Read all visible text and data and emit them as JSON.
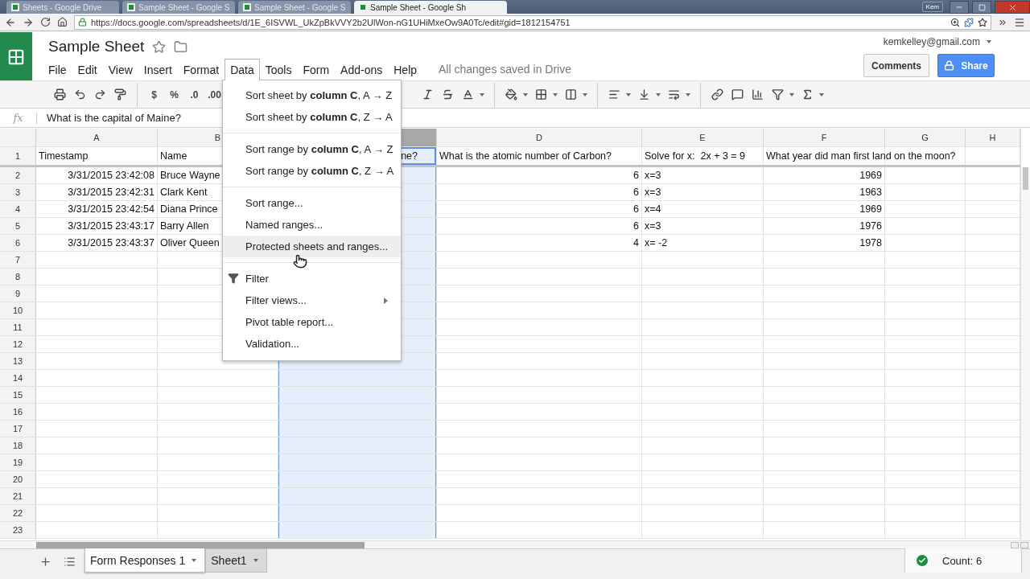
{
  "browser": {
    "tabs": [
      {
        "title": "Sheets - Google Drive",
        "selected": false
      },
      {
        "title": "Sample Sheet - Google S",
        "selected": false
      },
      {
        "title": "Sample Sheet - Google S",
        "selected": false
      },
      {
        "title": "Sample Sheet - Google Sh",
        "selected": true
      }
    ],
    "profile": "Kem",
    "url": "https://docs.google.com/spreadsheets/d/1E_6ISVWL_UkZpBkVVY2b2UlWon-nG1UHiMxeOw9A0Tc/edit#gid=1812154751"
  },
  "document": {
    "title": "Sample Sheet",
    "save_status": "All changes saved in Drive",
    "account": "kemkelley@gmail.com",
    "comments_button": "Comments",
    "share_button": "Share"
  },
  "menubar": [
    {
      "label": "File",
      "selected": false
    },
    {
      "label": "Edit",
      "selected": false
    },
    {
      "label": "View",
      "selected": false
    },
    {
      "label": "Insert",
      "selected": false
    },
    {
      "label": "Format",
      "selected": false
    },
    {
      "label": "Data",
      "selected": true
    },
    {
      "label": "Tools",
      "selected": false
    },
    {
      "label": "Form",
      "selected": false
    },
    {
      "label": "Add-ons",
      "selected": false
    },
    {
      "label": "Help",
      "selected": false
    }
  ],
  "toolbar": {
    "number_formats": [
      "$",
      "%",
      ".0",
      ".00"
    ]
  },
  "formula_bar": {
    "label": "fx",
    "value": "What is the capital of Maine?"
  },
  "sheet": {
    "columns": [
      {
        "label": "A",
        "selected": false
      },
      {
        "label": "B",
        "selected": false
      },
      {
        "selected": true
      },
      {
        "label": "D",
        "selected": false
      },
      {
        "label": "E",
        "selected": false
      },
      {
        "label": "F",
        "selected": false
      },
      {
        "label": "G",
        "selected": false
      },
      {
        "label": "H",
        "selected": false
      }
    ],
    "rows": [
      {
        "number": "1",
        "cells": [
          "Timestamp",
          "Name",
          "ne?",
          "What is the atomic number of Carbon?",
          "Solve for x:  2x + 3 = 9",
          "What year did man first land on the moon?"
        ]
      },
      {
        "number": "2",
        "cells": [
          "3/31/2015 23:42:08",
          "Bruce Wayne",
          null,
          "6",
          "x=3",
          "1969"
        ]
      },
      {
        "number": "3",
        "cells": [
          "3/31/2015 23:42:31",
          "Clark Kent",
          null,
          "6",
          "x=3",
          "1963"
        ]
      },
      {
        "number": "4",
        "cells": [
          "3/31/2015 23:42:54",
          "Diana Prince",
          null,
          "6",
          "x=4",
          "1969"
        ]
      },
      {
        "number": "5",
        "cells": [
          "3/31/2015 23:43:17",
          "Barry Allen",
          null,
          "6",
          "x=3",
          "1976"
        ]
      },
      {
        "number": "6",
        "cells": [
          "3/31/2015 23:43:37",
          "Oliver Queen",
          null,
          "4",
          "x= -2",
          "1978"
        ]
      },
      {
        "number": "7"
      },
      {
        "number": "8"
      },
      {
        "number": "9"
      },
      {
        "number": "10"
      },
      {
        "number": "11"
      },
      {
        "number": "12"
      },
      {
        "number": "13"
      },
      {
        "number": "14"
      },
      {
        "number": "15"
      },
      {
        "number": "16"
      },
      {
        "number": "17"
      },
      {
        "number": "18"
      },
      {
        "number": "19"
      },
      {
        "number": "20"
      },
      {
        "number": "21"
      },
      {
        "number": "22"
      },
      {
        "number": "23"
      }
    ]
  },
  "data_menu": {
    "items": [
      {
        "kind": "item",
        "label": "Sort sheet by **column C**, A → Z",
        "highlighted": false
      },
      {
        "kind": "item",
        "label": "Sort sheet by **column C**, Z → A",
        "highlighted": false
      },
      {
        "kind": "separator"
      },
      {
        "kind": "item",
        "label": "Sort range by **column C**, A → Z",
        "highlighted": false
      },
      {
        "kind": "item",
        "label": "Sort range by **column C**, Z → A",
        "highlighted": false
      },
      {
        "kind": "separator"
      },
      {
        "kind": "item",
        "label": "Sort range...",
        "highlighted": false
      },
      {
        "kind": "item",
        "label": "Named ranges...",
        "highlighted": false
      },
      {
        "kind": "item",
        "label": "Protected sheets and ranges...",
        "highlighted": true
      },
      {
        "kind": "separator"
      },
      {
        "kind": "filter",
        "label": "Filter",
        "highlighted": false
      },
      {
        "kind": "submenu",
        "label": "Filter views...",
        "highlighted": false
      },
      {
        "kind": "item",
        "label": "Pivot table report...",
        "highlighted": false
      },
      {
        "kind": "item",
        "label": "Validation...",
        "highlighted": false
      }
    ]
  },
  "sheet_tabs": [
    {
      "label": "Form Responses 1",
      "selected": true
    },
    {
      "label": "Sheet1",
      "selected": false
    }
  ],
  "status": {
    "summary": "Count: 6"
  }
}
